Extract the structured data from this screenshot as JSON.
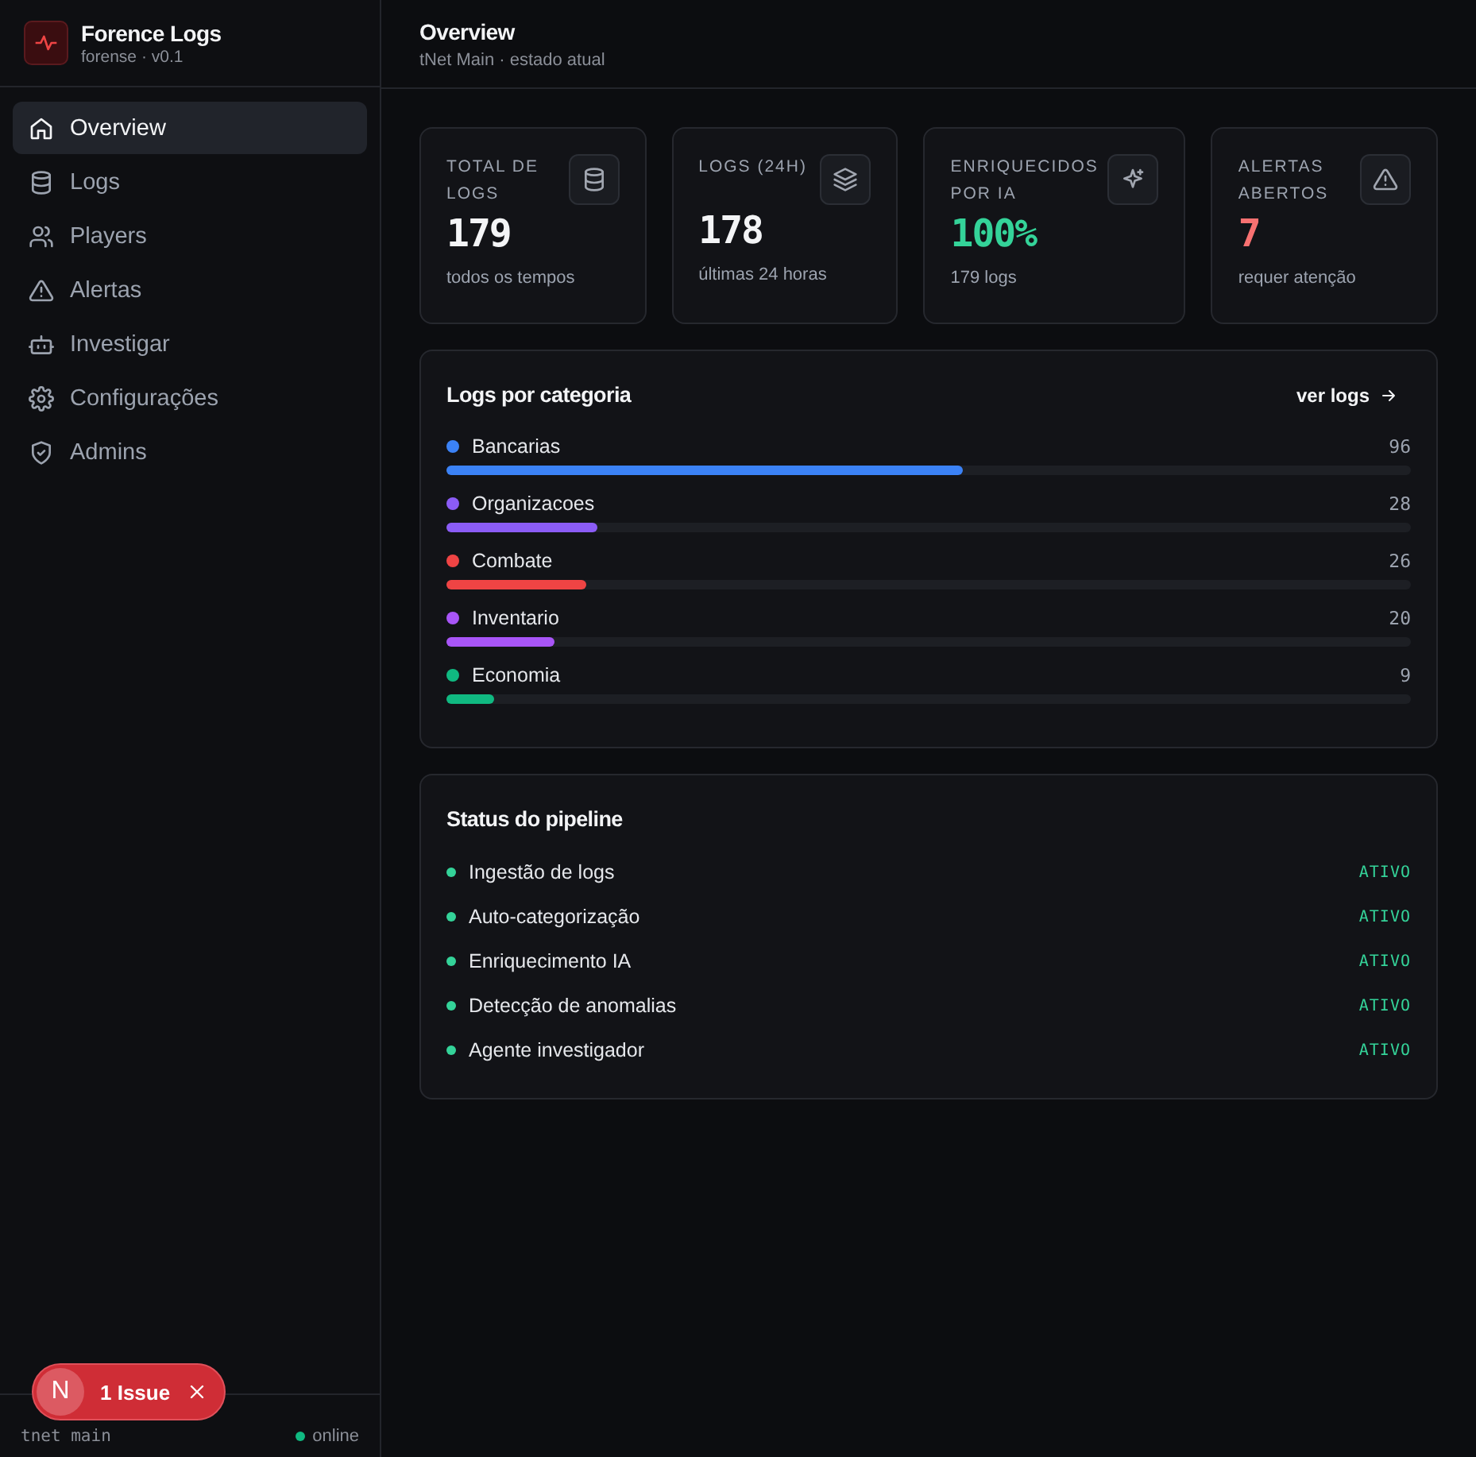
{
  "sidebar": {
    "brand": {
      "title": "Forence Logs",
      "subtitle": "forense · v0.1"
    },
    "items": [
      {
        "label": "Overview",
        "selected": true
      },
      {
        "label": "Logs",
        "selected": false
      },
      {
        "label": "Players",
        "selected": false
      },
      {
        "label": "Alertas",
        "selected": false
      },
      {
        "label": "Investigar",
        "selected": false
      },
      {
        "label": "Configurações",
        "selected": false
      },
      {
        "label": "Admins",
        "selected": false
      }
    ],
    "footer": {
      "server": "tnet main",
      "status": "online"
    }
  },
  "header": {
    "title": "Overview",
    "subtitle": "tNet Main · estado atual"
  },
  "stats": [
    {
      "label": "TOTAL DE LOGS",
      "value": "179",
      "note": "todos os tempos",
      "color": "#f3f4f6"
    },
    {
      "label": "LOGS (24H)",
      "value": "178",
      "note": "últimas 24 horas",
      "color": "#f3f4f6"
    },
    {
      "label": "ENRIQUECIDOS POR IA",
      "value": "100%",
      "note": "179 logs",
      "color": "#34d399"
    },
    {
      "label": "ALERTAS ABERTOS",
      "value": "7",
      "note": "requer atenção",
      "color": "#f87171"
    }
  ],
  "categories": {
    "title": "Logs por categoria",
    "link": "ver logs",
    "items": [
      {
        "name": "Bancarias",
        "count": "96",
        "color": "#3b82f6",
        "level": 0.536
      },
      {
        "name": "Organizacoes",
        "count": "28",
        "color": "#8b5cf6",
        "level": 0.156
      },
      {
        "name": "Combate",
        "count": "26",
        "color": "#ef4444",
        "level": 0.145
      },
      {
        "name": "Inventario",
        "count": "20",
        "color": "#a855f7",
        "level": 0.112
      },
      {
        "name": "Economia",
        "count": "9",
        "color": "#10b981",
        "level": 0.05
      }
    ]
  },
  "pipeline": {
    "title": "Status do pipeline",
    "items": [
      {
        "name": "Ingestão de logs",
        "status": "ATIVO"
      },
      {
        "name": "Auto-categorização",
        "status": "ATIVO"
      },
      {
        "name": "Enriquecimento IA",
        "status": "ATIVO"
      },
      {
        "name": "Detecção de anomalias",
        "status": "ATIVO"
      },
      {
        "name": "Agente investigador",
        "status": "ATIVO"
      }
    ]
  },
  "issue_badge": {
    "letter": "N",
    "label": "1 Issue"
  }
}
